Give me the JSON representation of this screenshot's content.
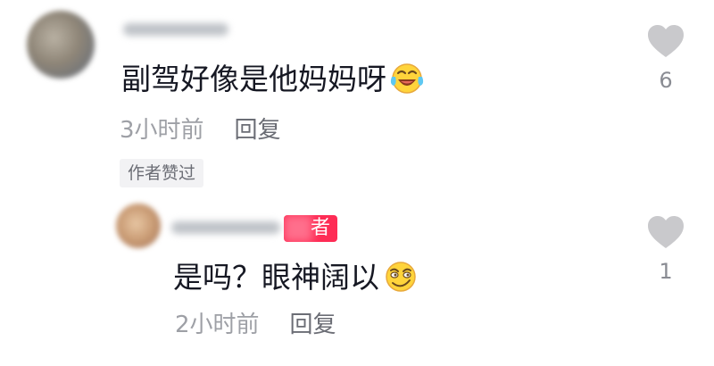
{
  "comment": {
    "text": "副驾好像是他妈妈呀",
    "emoji_icon": "laughing-crying-emoji",
    "time": "3小时前",
    "reply_label": "回复",
    "liked_by_author_badge": "作者赞过",
    "likes": "6"
  },
  "reply": {
    "author_tag": "者",
    "text": "是吗？眼神阔以",
    "emoji_icon": "smirk-emoji",
    "time": "2小时前",
    "reply_label": "回复",
    "likes": "1"
  },
  "colors": {
    "author_tag": "#fe2c55",
    "heart": "#c9c9cc",
    "time_text": "#9ea0a6",
    "main_text": "#161823"
  }
}
